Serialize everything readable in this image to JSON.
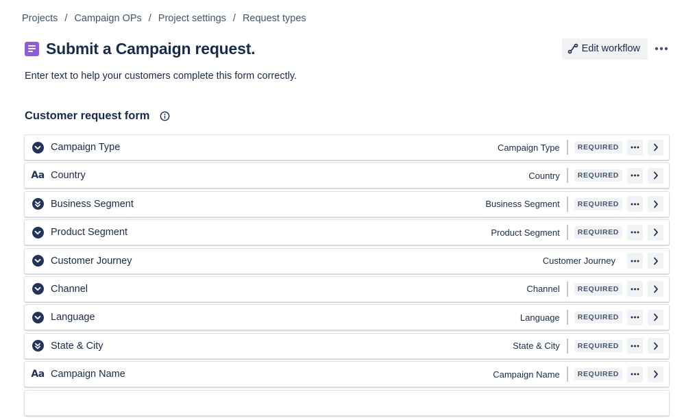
{
  "breadcrumb": {
    "items": [
      "Projects",
      "Campaign OPs",
      "Project settings",
      "Request types"
    ],
    "separator": "/"
  },
  "header": {
    "title": "Submit a Campaign request.",
    "icon": "request-type-icon",
    "icon_color": "#8f5bd8",
    "edit_workflow_label": "Edit workflow"
  },
  "description": "Enter text to help your customers complete this form correctly.",
  "form": {
    "title": "Customer request form",
    "required_label": "REQUIRED",
    "fields": [
      {
        "label": "Campaign Type",
        "field_name": "Campaign Type",
        "icon": "select-icon",
        "required": true
      },
      {
        "label": "Country",
        "field_name": "Country",
        "icon": "text-field-icon",
        "required": true
      },
      {
        "label": "Business Segment",
        "field_name": "Business Segment",
        "icon": "multi-select-icon",
        "required": true
      },
      {
        "label": "Product Segment",
        "field_name": "Product Segment",
        "icon": "select-icon",
        "required": true
      },
      {
        "label": "Customer Journey",
        "field_name": "Customer Journey",
        "icon": "select-icon",
        "required": false
      },
      {
        "label": "Channel",
        "field_name": "Channel",
        "icon": "select-icon",
        "required": true
      },
      {
        "label": "Language",
        "field_name": "Language",
        "icon": "select-icon",
        "required": true
      },
      {
        "label": "State & City",
        "field_name": "State & City",
        "icon": "multi-select-icon",
        "required": true
      },
      {
        "label": "Campaign Name",
        "field_name": "Campaign Name",
        "icon": "text-field-icon",
        "required": true
      }
    ]
  }
}
